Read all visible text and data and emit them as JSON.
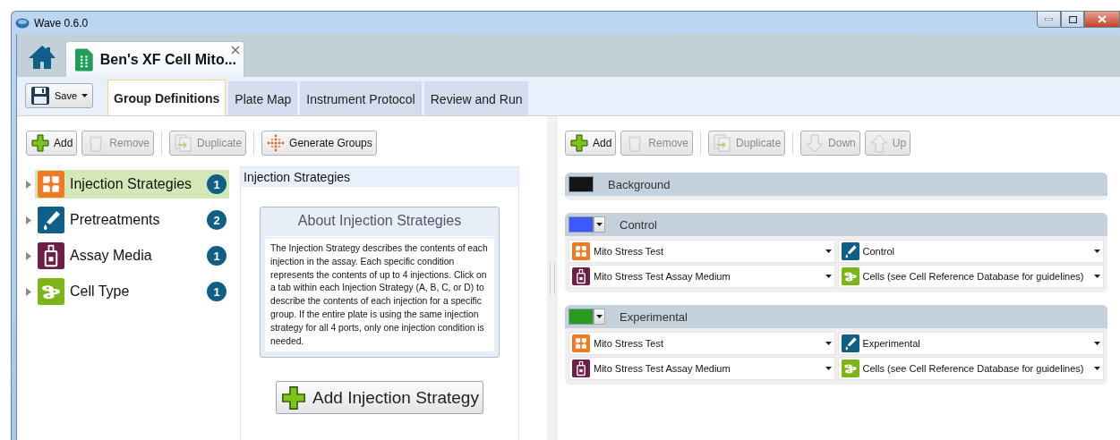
{
  "window": {
    "title": "Wave 0.6.0"
  },
  "document_tab": {
    "title": "Ben's XF Cell Mito..."
  },
  "save_button": {
    "label": "Save"
  },
  "tabs": [
    {
      "label": "Group Definitions",
      "selected": true
    },
    {
      "label": "Plate Map",
      "selected": false
    },
    {
      "label": "Instrument Protocol",
      "selected": false
    },
    {
      "label": "Review and Run",
      "selected": false
    }
  ],
  "left_toolbar": [
    {
      "kind": "add",
      "label": "Add",
      "disabled": false
    },
    {
      "kind": "remove",
      "label": "Remove",
      "disabled": true
    },
    {
      "kind": "duplicate",
      "label": "Duplicate",
      "disabled": true
    },
    {
      "kind": "generate",
      "label": "Generate Groups",
      "disabled": false
    }
  ],
  "tree": [
    {
      "kind": "injection",
      "label": "Injection Strategies",
      "count": "1",
      "selected": true
    },
    {
      "kind": "pretreatment",
      "label": "Pretreatments",
      "count": "2",
      "selected": false
    },
    {
      "kind": "media",
      "label": "Assay Media",
      "count": "1",
      "selected": false
    },
    {
      "kind": "cell",
      "label": "Cell Type",
      "count": "1",
      "selected": false
    }
  ],
  "detail": {
    "title": "Injection Strategies",
    "about_title": "About Injection Strategies",
    "about_text": "The Injection Strategy describes the contents of each injection in the assay. Each specific condition represents the contents of up to 4 injections. Click on a tab within each Injection Strategy (A, B, C, or D) to describe the contents of each injection for a specific group. If the entire plate is using the same injection strategy for all 4 ports, only one injection condition is needed.",
    "add_button": "Add Injection Strategy"
  },
  "right_toolbar": [
    {
      "kind": "add",
      "label": "Add",
      "disabled": false
    },
    {
      "kind": "remove",
      "label": "Remove",
      "disabled": true
    },
    {
      "kind": "duplicate",
      "label": "Duplicate",
      "disabled": true
    },
    {
      "kind": "down",
      "label": "Down",
      "disabled": true
    },
    {
      "kind": "up",
      "label": "Up",
      "disabled": true
    }
  ],
  "groups": [
    {
      "name": "Background",
      "color": "#151515",
      "color_menu": false
    },
    {
      "name": "Control",
      "color": "#3d5afe",
      "color_menu": true,
      "fields": [
        {
          "kind": "injection",
          "value": "Mito Stress Test"
        },
        {
          "kind": "pretreatment",
          "value": "Control"
        },
        {
          "kind": "media",
          "value": "Mito Stress Test Assay Medium"
        },
        {
          "kind": "cell",
          "value": "Cells (see Cell Reference Database for guidelines)"
        }
      ]
    },
    {
      "name": "Experimental",
      "color": "#2a9a1e",
      "color_menu": true,
      "fields": [
        {
          "kind": "injection",
          "value": "Mito Stress Test"
        },
        {
          "kind": "pretreatment",
          "value": "Experimental"
        },
        {
          "kind": "media",
          "value": "Mito Stress Test Assay Medium"
        },
        {
          "kind": "cell",
          "value": "Cells (see Cell Reference Database for guidelines)"
        }
      ]
    }
  ]
}
